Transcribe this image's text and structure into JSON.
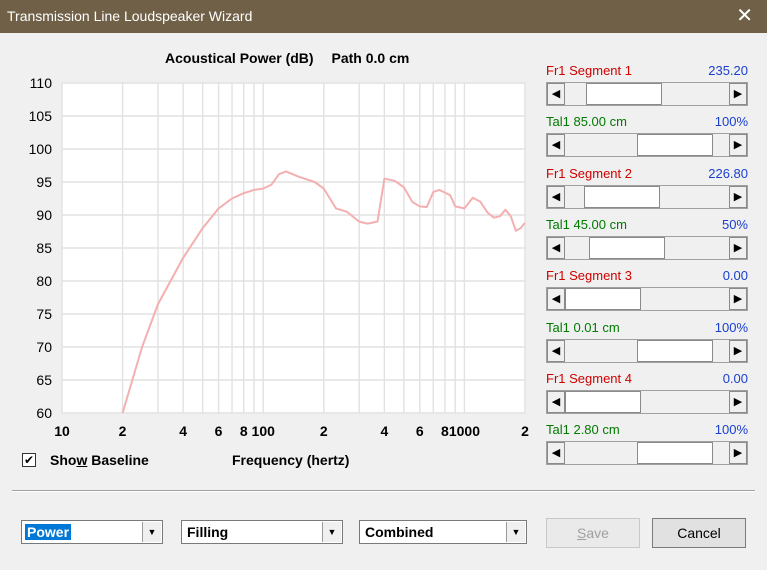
{
  "window": {
    "title": "Transmission Line Loudspeaker Wizard"
  },
  "chart_header": {
    "title": "Acoustical Power (dB)",
    "path": "Path 0.0 cm"
  },
  "chart_data": {
    "type": "line",
    "title": "Acoustical Power (dB)   Path 0.0 cm",
    "xlabel": "Frequency (hertz)",
    "ylabel": "",
    "x_scale": "log",
    "xlim": [
      10,
      2000
    ],
    "ylim": [
      60,
      110
    ],
    "x_tick_labels": [
      {
        "v": 10,
        "t": "10"
      },
      {
        "v": 20,
        "t": "2"
      },
      {
        "v": 40,
        "t": "4"
      },
      {
        "v": 60,
        "t": "6"
      },
      {
        "v": 80,
        "t": "8"
      },
      {
        "v": 100,
        "t": "100"
      },
      {
        "v": 200,
        "t": "2"
      },
      {
        "v": 400,
        "t": "4"
      },
      {
        "v": 600,
        "t": "6"
      },
      {
        "v": 800,
        "t": "8"
      },
      {
        "v": 1000,
        "t": "1000"
      },
      {
        "v": 2000,
        "t": "2"
      }
    ],
    "y_ticks": [
      60,
      65,
      70,
      75,
      80,
      85,
      90,
      95,
      100,
      105,
      110
    ],
    "grid": true,
    "line_color": "#f4b0b0",
    "series": [
      {
        "x": [
          20,
          25,
          30,
          40,
          50,
          60,
          70,
          80,
          90,
          100,
          110,
          120,
          130,
          150,
          180,
          200,
          230,
          260,
          300,
          330,
          370,
          400,
          450,
          500,
          550,
          600,
          650,
          700,
          750,
          800,
          850,
          900,
          1000,
          1100,
          1200,
          1300,
          1400,
          1500,
          1600,
          1700,
          1800,
          1900,
          2000
        ],
        "y": [
          60,
          70,
          76.5,
          83.5,
          88,
          91,
          92.5,
          93.3,
          93.8,
          94,
          94.6,
          96.2,
          96.6,
          95.8,
          95,
          94,
          91,
          90.5,
          89,
          88.7,
          89,
          95.5,
          95.2,
          94.2,
          92,
          91.3,
          91.2,
          93.5,
          93.8,
          93.4,
          93,
          91.3,
          91,
          92.6,
          92,
          90.4,
          89.6,
          89.8,
          90.8,
          89.8,
          87.6,
          88,
          88.8
        ]
      }
    ]
  },
  "sliders": [
    {
      "left": "Fr1  Segment 1",
      "right": "235.20",
      "kind": "red",
      "value": 0.24
    },
    {
      "left": "Tal1  85.00 cm",
      "right": "100%",
      "kind": "green",
      "value": 0.82
    },
    {
      "left": "Fr1  Segment 2",
      "right": "226.80",
      "kind": "red",
      "value": 0.22
    },
    {
      "left": "Tal1  45.00 cm",
      "right": "50%",
      "kind": "green",
      "value": 0.27
    },
    {
      "left": "Fr1  Segment 3",
      "right": "0.00",
      "kind": "red",
      "value": 0.0
    },
    {
      "left": "Tal1  0.01 cm",
      "right": "100%",
      "kind": "green",
      "value": 0.82
    },
    {
      "left": "Fr1  Segment 4",
      "right": "0.00",
      "kind": "red",
      "value": 0.0
    },
    {
      "left": "Tal1  2.80 cm",
      "right": "100%",
      "kind": "green",
      "value": 0.82
    }
  ],
  "baseline": {
    "checked": true,
    "label_pre": "Sho",
    "label_key": "w",
    "label_post": " Baseline"
  },
  "frequency_label": "Frequency (hertz)",
  "dropdowns": [
    {
      "value": "Power",
      "selected": true
    },
    {
      "value": "Filling",
      "selected": false
    },
    {
      "value": "Combined",
      "selected": false
    }
  ],
  "buttons": {
    "save_key": "S",
    "save_rest": "ave",
    "cancel": "Cancel"
  },
  "icons": {
    "close": "close-icon",
    "left": "arrow-left-icon",
    "right": "arrow-right-icon",
    "dropdown": "chevron-down-icon",
    "check": "check-icon"
  }
}
